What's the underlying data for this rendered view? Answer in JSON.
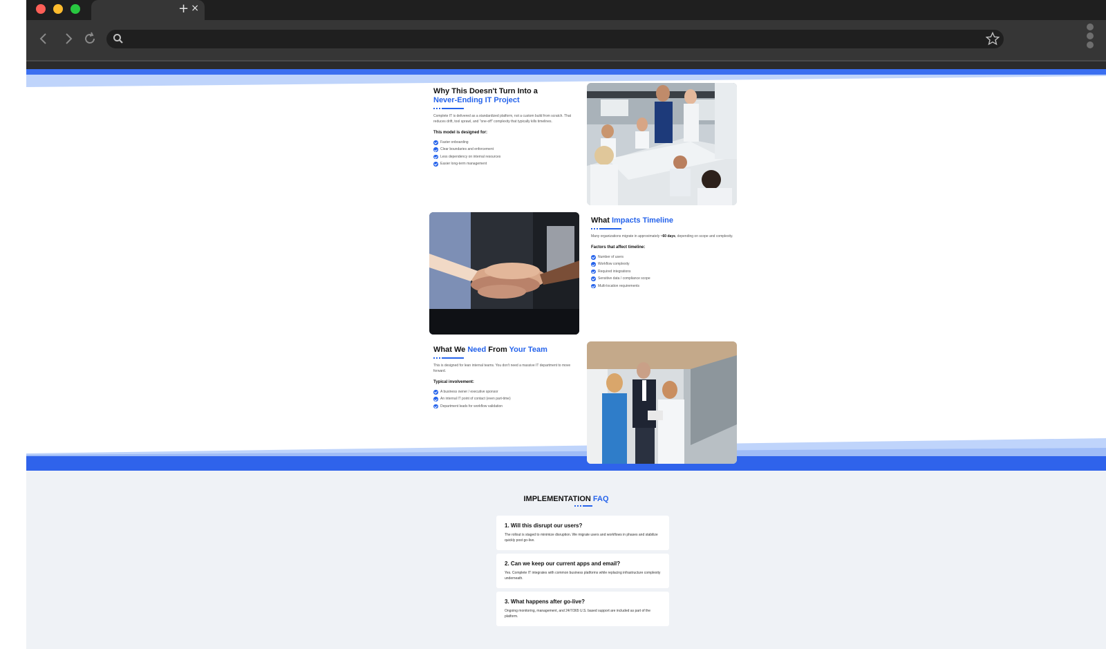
{
  "browser": {
    "tab_close": "×",
    "new_tab": "+",
    "nav": {
      "back": "‹",
      "forward": "›"
    },
    "icons": [
      "back-arrow-icon",
      "forward-arrow-icon",
      "reload-icon",
      "search-icon",
      "star-icon",
      "menu-dots-icon"
    ]
  },
  "colors": {
    "accent": "#2563eb",
    "accent_light": "#bfd4fb",
    "text": "#111111",
    "faq_bg": "#eff2f6"
  },
  "sections": [
    {
      "title_parts": [
        "Why This Doesn't Turn Into a",
        "Never-Ending IT Project"
      ],
      "paragraph": "Complete IT is delivered as a standardized platform, not a custom build from scratch. That reduces drift, tool sprawl, and \"one-off\" complexity that typically kills timelines.",
      "subheading": "This model is designed for:",
      "items": [
        "Faster onboarding",
        "Clear boundaries and enforcement",
        "Less dependency on internal resources",
        "Easier long-term management"
      ]
    },
    {
      "title_parts": [
        "What",
        "Impacts Timeline"
      ],
      "paragraph_parts": [
        "Many organizations migrate in approximately",
        "~60 days",
        ", depending on scope and complexity."
      ],
      "subheading": "Factors that affect timeline:",
      "items": [
        "Number of users",
        "Workflow complexity",
        "Required integrations",
        "Sensitive data / compliance scope",
        "Multi-location requirements"
      ]
    },
    {
      "title_parts": [
        "What We",
        "Need",
        "From",
        "Your Team"
      ],
      "paragraph": "This is designed for lean internal teams. You don't need a massive IT department to move forward.",
      "subheading": "Typical involvement:",
      "items": [
        "A business owner / executive sponsor",
        "An internal IT point of contact (even part-time)",
        "Department leads for workflow validation"
      ]
    }
  ],
  "faq": {
    "title_parts": [
      "IMPLEMENTATION",
      "FAQ"
    ],
    "items": [
      {
        "q": "1. Will this disrupt our users?",
        "a": "The rollout is staged to minimize disruption. We migrate users and workflows in phases and stabilize quickly post go-live."
      },
      {
        "q": "2. Can we keep our current apps and email?",
        "a": "Yes. Complete IT integrates with common business platforms while replacing infrastructure complexity underneath."
      },
      {
        "q": "3. What happens after go-live?",
        "a": "Ongoing monitoring, management, and 24/7/365 U.S. based support are included as part of the platform."
      }
    ]
  }
}
